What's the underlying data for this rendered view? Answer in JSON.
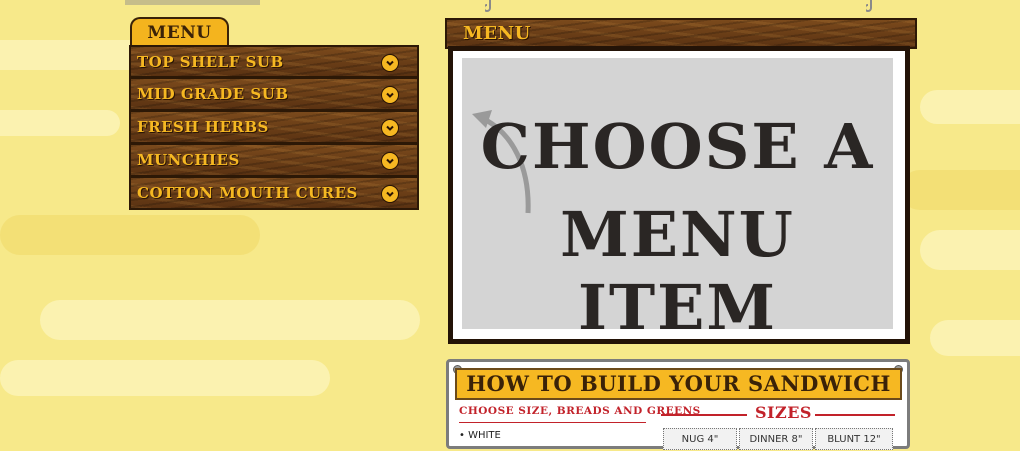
{
  "menu": {
    "tab_label": "MENU",
    "items": [
      {
        "label": "TOP SHELF SUB"
      },
      {
        "label": "MID GRADE SUB"
      },
      {
        "label": "FRESH HERBS"
      },
      {
        "label": "MUNCHIES"
      },
      {
        "label": "COTTON MOUTH CURES"
      }
    ]
  },
  "sign": {
    "title": "MENU",
    "line1": "CHOOSE A",
    "line2": "MENU ITEM"
  },
  "build": {
    "banner": "HOW TO BUILD YOUR SANDWICH",
    "subheading": "CHOOSE SIZE, BREADS AND GREENS",
    "sizes_title": "SIZES",
    "bread_first": "• WHITE",
    "sizes": [
      "NUG 4\"",
      "DINNER 8\"",
      "BLUNT 12\""
    ]
  },
  "colors": {
    "wood": "#6a3f17",
    "gold": "#f6b822",
    "red": "#c2222a",
    "background": "#f7e98a"
  }
}
